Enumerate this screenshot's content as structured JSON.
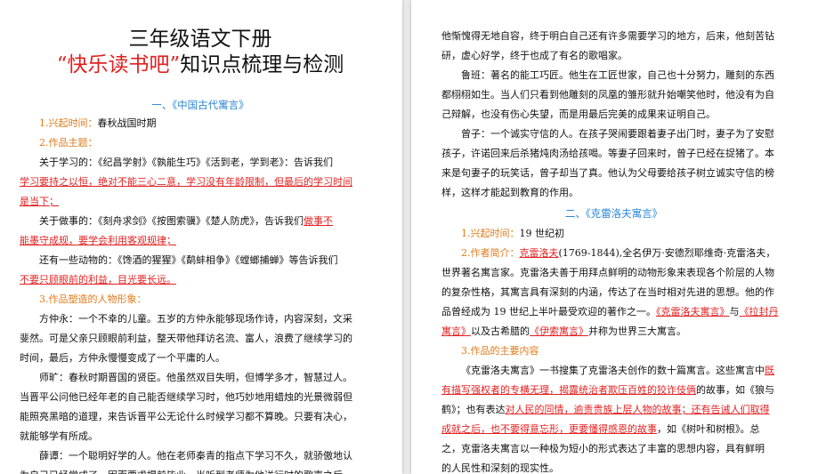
{
  "left": {
    "title_line1": "三年级语文下册",
    "title_quote_open": "“",
    "title_highlight": "快乐读书吧",
    "title_quote_close": "”",
    "title_rest": "知识点梳理与检测",
    "section1": "一、《中国古代寓言》",
    "p1_label": "1.兴起时间：",
    "p1_text": "春秋战国时期",
    "p2_label": "2.作品主题：",
    "p3_a": "关于学习的：《纪昌学射》《孰能生巧》《活到老，学到老》：告诉我们",
    "p3_b": "学习要持之以恒，绝对不能三心二意，学习没有年龄限制，但最后的学习时间",
    "p3_c": "是当下；",
    "p4_a_plain": "关于做事的：《刻舟求剑》《按图索骥》《楚人防虎》，告诉我们",
    "p4_a_red": "做事不",
    "p4_b": "能墨守成规，要学会利用客观规律；",
    "p5_a": "还有一些动物的：《馋酒的猩猩》《鹬蚌相争》《螳螂捕蝉》等告诉我们",
    "p5_b_red": "不要只顾眼前的利益，目光要长远。",
    "p6_label": "3.作品塑造的人物形象：",
    "p7_a": "方仲永：一个不幸的儿童。五岁的方仲永能够现场作诗，内容深刻，文采",
    "p7_b": "斐然。可是父亲只顾眼前利益，整天带他拜访名流、富人，浪费了继续学习的",
    "p7_c": "时间，最后，方仲永慢慢变成了一个平庸的人。",
    "p8_a": "师旷：春秋时期晋国的贤臣。他虽然双目失明，但博学多才，智慧过人。",
    "p8_b": "当晋平公问他已经年老的自己能否继续学习时，他巧妙地用蜡烛的光景微弱但",
    "p8_c": "能照亮黑暗的道理，来告诉晋平公无论什么时候学习都不算晚。只要有决心，",
    "p8_d": "就能够学有所成。",
    "p9_a": "薛谭：一个聪明好学的人。他在老师秦青的指点下学习不久，就骄傲地认",
    "p9_b": "为自己已经学成了，因而要求提前毕业。当听到老师为他送行时的歌声之后，"
  },
  "right": {
    "r1": "他惭愧得无地自容，终于明白自己还有许多需要学习的地方，后来，他刻苦钻",
    "r2": "研，虚心好学，终于也成了有名的歌唱家。",
    "r3": "鲁班：著名的能工巧匠。他生在工匠世家，自己也十分努力，雕刻的东西",
    "r4": "都栩栩如生。当人们只看到他雕刻的凤凰的雏形就升始嘲笑他时，他没有为自",
    "r5": "己辩解，也没有伤心失望，而是用最后完美的成果来证明自己。",
    "r6": "曾子：一个诚实守信的人。在孩子哭闹要跟着妻子出门时，妻子为了安慰",
    "r7": "孩子，许诺回来后杀猪炖肉汤给孩喝。等妻子回来时，曾子已经在捉猪了。本",
    "r8": "来是句妻子的玩笑话，曾子却当了真。他认为父母要给孩子树立诚实守信的榜",
    "r9": "样，这样才能起到教育的作用。",
    "section2": "二、《克雷洛夫寓言》",
    "s1_label": "1.兴起时间：",
    "s1_text": "19 世纪初",
    "s2_label": "2.作者简介：",
    "s2_name": "克雷洛夫",
    "s2_text": "(1769-1844),全名伊万·安德烈耶维奇·克雷洛夫，",
    "s3": "世界著名寓言家。克雷洛夫善于用拜点鲜明的动物形象来表现各个阶层的人物",
    "s4": "的复杂性格，其寓言具有深刻的内涵，传达了在当时相对先进的思想。他的作",
    "s5_a": "品曾经成为 19 世纪上半叶最受欢迎的著作之一。",
    "s5_b": "《克雷洛夫寓言》",
    "s5_c": "与",
    "s5_d": "《拉封丹",
    "s6_a": "寓言》",
    "s6_b": "以及古希腊的",
    "s6_c": "《伊索寓言》",
    "s6_d": "并称为世界三大寓言。",
    "s7_label": "3.作品的主要内容",
    "s8_a": "《克雷洛夫寓言》一书搜集了克雷洛夫创作的数十篇寓言。这些寓言中",
    "s8_b": "既",
    "s9_a": "有描写强权者的专横无理，揭露统治者欺压百姓的狡诈伎俩",
    "s9_b": "的故事，如《狼与",
    "s10_a": "鹤》；也有表达",
    "s10_b": "对人民的同情，逾责贵族上层人物的故事；还有告诫人们取得",
    "s11_a": "成就之后，也不要得意忘形，更要懂得感恩的故事",
    "s11_b": "，如《树叶和树根》。总",
    "s12": "之，克雷洛夫寓言以一种极为短小的形式表达了丰富的思想内容，具有鲜明",
    "s13": "的人民性和深刻的现实性。"
  }
}
